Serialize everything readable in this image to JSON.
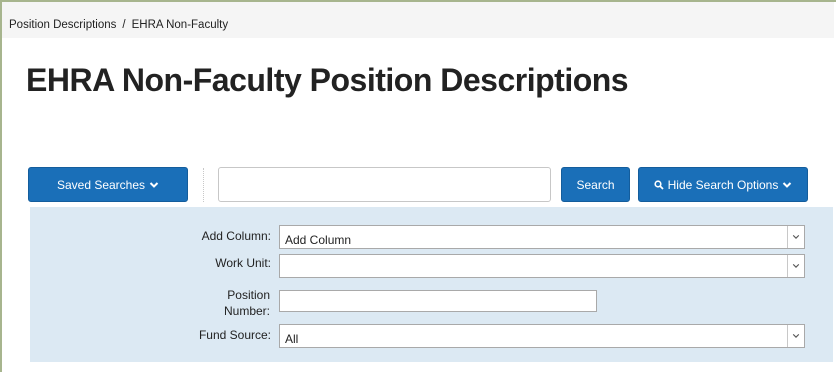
{
  "breadcrumb": {
    "items": [
      "Position Descriptions",
      "EHRA Non-Faculty"
    ],
    "separator": "/"
  },
  "page": {
    "title": "EHRA Non-Faculty Position Descriptions"
  },
  "toolbar": {
    "saved_searches_label": "Saved Searches",
    "search_value": "",
    "search_label": "Search",
    "hide_options_label": "Hide Search Options",
    "accent_color": "#1a6fb8"
  },
  "search_options": {
    "add_column": {
      "label": "Add Column:",
      "value": "Add Column"
    },
    "work_unit": {
      "label": "Work Unit:",
      "value": ""
    },
    "position_number": {
      "label_line1": "Position",
      "label_line2": "Number:",
      "value": ""
    },
    "fund_source": {
      "label": "Fund Source:",
      "value": "All"
    },
    "panel_color": "#dce9f3"
  }
}
